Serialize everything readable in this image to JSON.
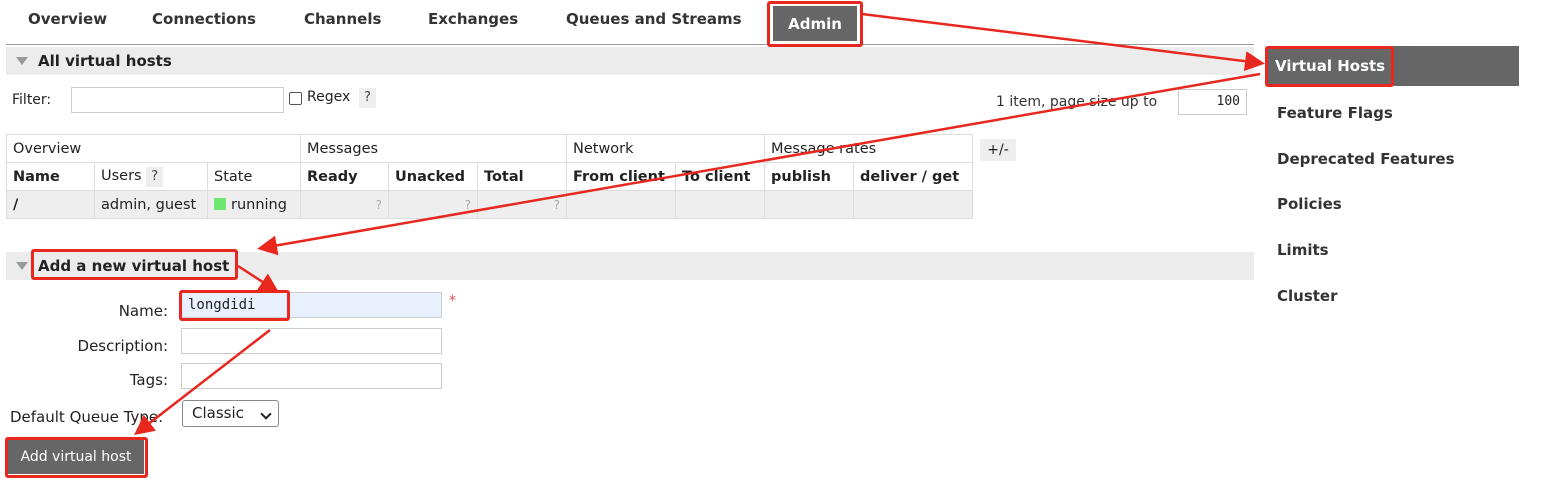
{
  "nav": {
    "tabs": [
      "Overview",
      "Connections",
      "Channels",
      "Exchanges",
      "Queues and Streams",
      "Admin"
    ],
    "active": "Admin"
  },
  "all_vhosts": {
    "title": "All virtual hosts",
    "filter_label": "Filter:",
    "filter_value": "",
    "regex_label": "Regex",
    "help": "?",
    "paging_text": "1 item, page size up to",
    "page_size": "100"
  },
  "table": {
    "group_headers": [
      "Overview",
      "Messages",
      "Network",
      "Message rates"
    ],
    "columns": [
      "Name",
      "Users",
      "State",
      "Ready",
      "Unacked",
      "Total",
      "From client",
      "To client",
      "publish",
      "deliver / get"
    ],
    "users_help": "?",
    "toggle_label": "+/-",
    "rows": [
      {
        "name": "/",
        "users": "admin, guest",
        "state": "running",
        "ready": "?",
        "unacked": "?",
        "total": "?",
        "from_client": "",
        "to_client": "",
        "publish": "",
        "deliver_get": ""
      }
    ]
  },
  "add_vhost": {
    "title": "Add a new virtual host",
    "name_label": "Name:",
    "name_value": "longdidi",
    "required_mark": "*",
    "description_label": "Description:",
    "description_value": "",
    "tags_label": "Tags:",
    "tags_value": "",
    "queue_type_label": "Default Queue Type:",
    "queue_type_value": "Classic",
    "submit_label": "Add virtual host"
  },
  "sidebar": {
    "items": [
      "Virtual Hosts",
      "Feature Flags",
      "Deprecated Features",
      "Policies",
      "Limits",
      "Cluster"
    ],
    "active": "Virtual Hosts"
  },
  "colors": {
    "annotation_red": "#e8271f",
    "active_bg": "#666666",
    "running_green": "#6ee76e"
  }
}
